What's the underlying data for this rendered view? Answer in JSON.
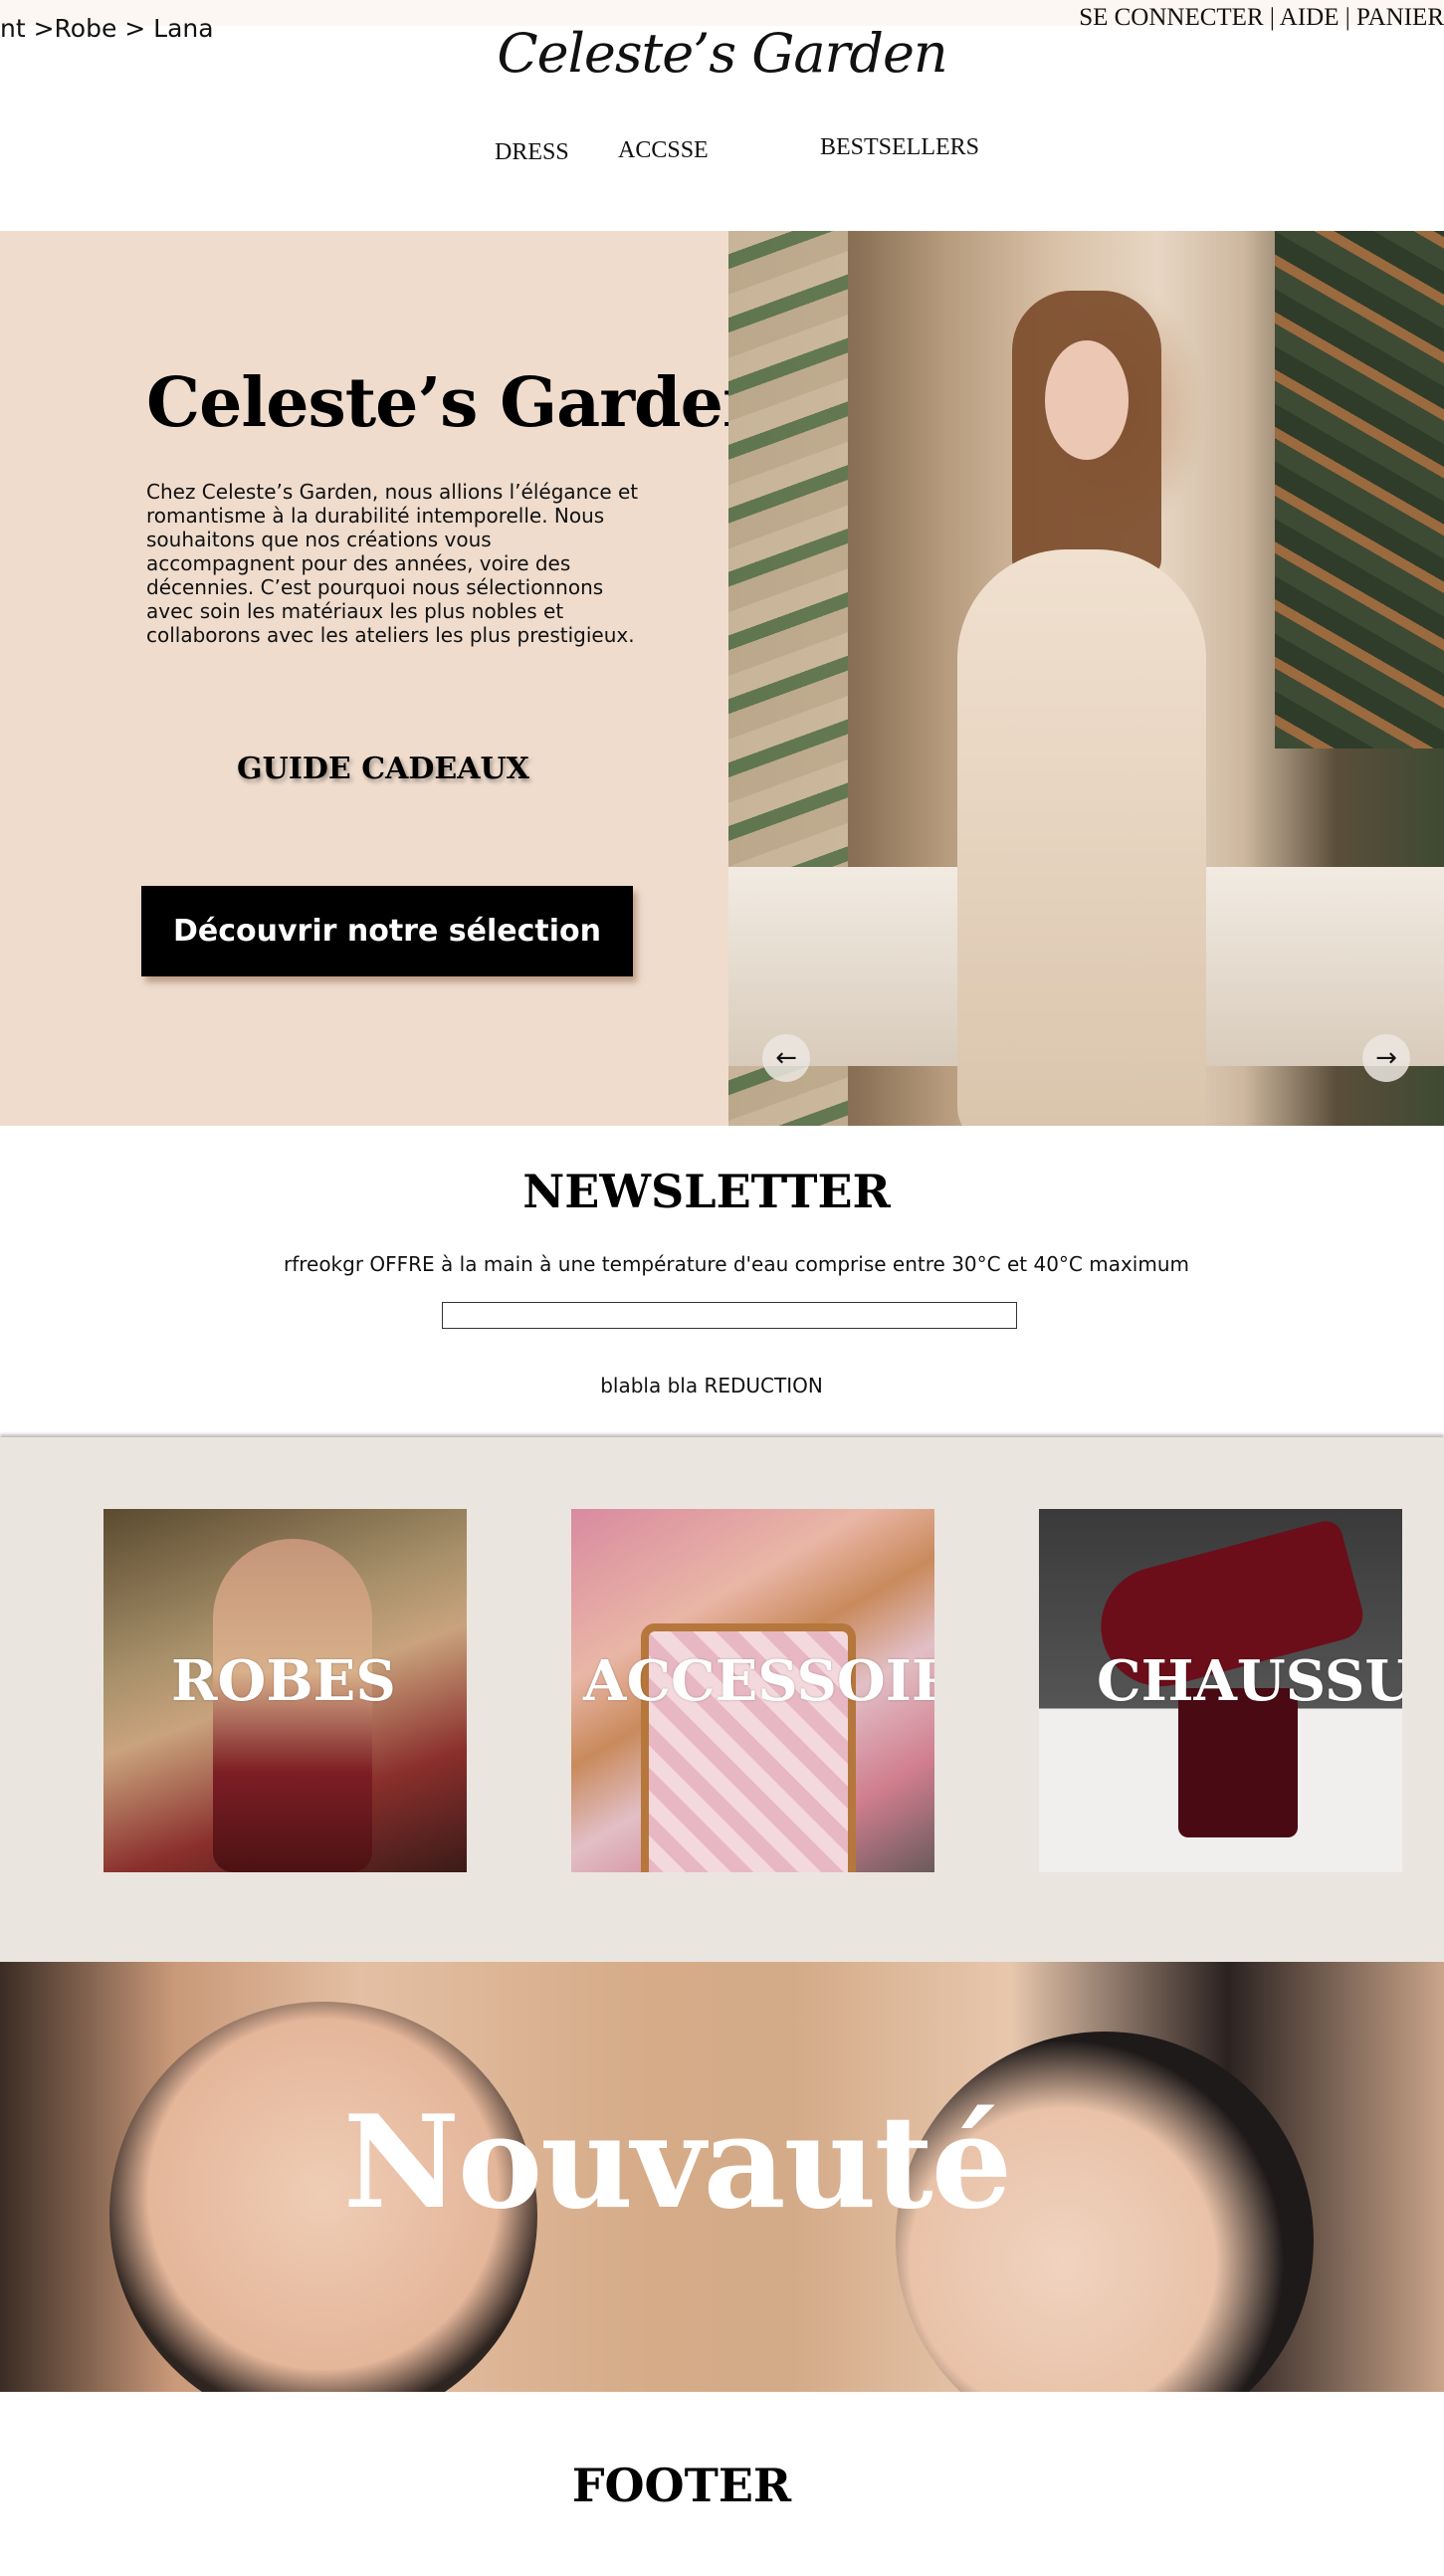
{
  "header": {
    "breadcrumb": "nt >Robe > Lana",
    "account_links": [
      "SE CONNECTER",
      "AIDE",
      "PANIER"
    ],
    "separator": " | ",
    "logo": "Celeste’s Garden",
    "nav": [
      "DRESS",
      "ACCSSE",
      "BESTSELLERS"
    ]
  },
  "hero": {
    "title": "Celeste’s Garden",
    "text": "Chez Celeste’s Garden, nous allions l’élégance et romantisme à la durabilité intemporelle. Nous souhaitons que nos créations vous accompagnent pour des années, voire des décennies. C’est pourquoi nous sélectionnons avec soin les matériaux les plus nobles et collaborons avec les ateliers les plus prestigieux.",
    "gift_guide": "GUIDE CADEAUX",
    "cta_label": "Découvrir notre sélection",
    "prev_arrow": "←",
    "next_arrow": "→"
  },
  "newsletter": {
    "title": "NEWSLETTER",
    "text": "rfreokgr OFFRE  à la main à une température d'eau comprise entre 30°C et 40°C maximum",
    "input_value": "",
    "promo": "blabla bla REDUCTION"
  },
  "categories": [
    {
      "label": "ROBES"
    },
    {
      "label": "ACCESSOIRES"
    },
    {
      "label": "CHAUSSURES"
    }
  ],
  "banner": {
    "title": "Nouvauté"
  },
  "footer": {
    "title": "FOOTER"
  }
}
